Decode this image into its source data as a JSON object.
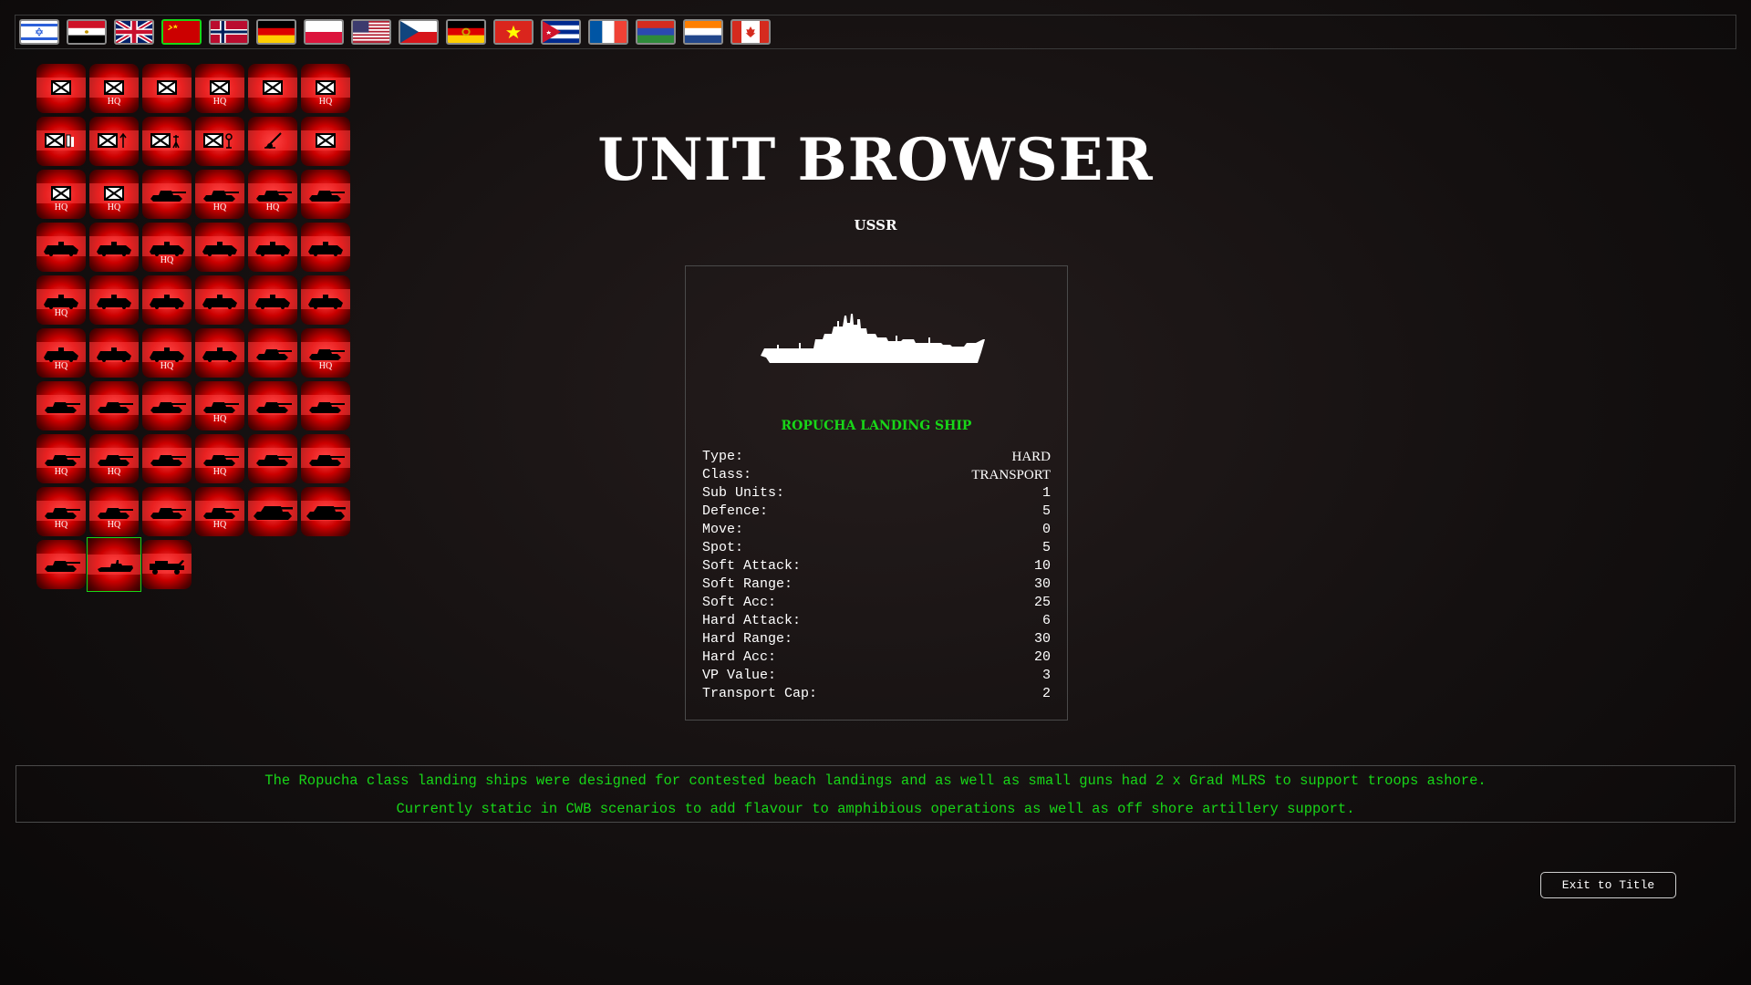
{
  "header": {
    "title": "UNIT BROWSER",
    "nation": "USSR"
  },
  "flags": [
    {
      "name": "israel-flag",
      "selected": false
    },
    {
      "name": "egypt-flag",
      "selected": false
    },
    {
      "name": "uk-flag",
      "selected": false
    },
    {
      "name": "ussr-flag",
      "selected": true
    },
    {
      "name": "norway-flag",
      "selected": false
    },
    {
      "name": "west-germany-flag",
      "selected": false
    },
    {
      "name": "poland-flag",
      "selected": false
    },
    {
      "name": "usa-flag",
      "selected": false
    },
    {
      "name": "czechoslovakia-flag",
      "selected": false
    },
    {
      "name": "east-germany-flag",
      "selected": false
    },
    {
      "name": "vietnam-flag",
      "selected": false
    },
    {
      "name": "cuba-flag",
      "selected": false
    },
    {
      "name": "france-flag",
      "selected": false
    },
    {
      "name": "red-blue-green-flag",
      "selected": false
    },
    {
      "name": "netherlands-flag",
      "selected": false
    },
    {
      "name": "canada-flag",
      "selected": false
    }
  ],
  "units": [
    {
      "icon": "infantry-icon",
      "hq": false
    },
    {
      "icon": "infantry-icon",
      "hq": true
    },
    {
      "icon": "infantry-icon",
      "hq": false
    },
    {
      "icon": "infantry-icon",
      "hq": true
    },
    {
      "icon": "infantry-icon",
      "hq": false
    },
    {
      "icon": "infantry-icon",
      "hq": true
    },
    {
      "icon": "infantry-mortar-icon",
      "hq": false
    },
    {
      "icon": "infantry-atgm-icon",
      "hq": false
    },
    {
      "icon": "infantry-mg-icon",
      "hq": false
    },
    {
      "icon": "infantry-aa-icon",
      "hq": false
    },
    {
      "icon": "artillery-gun-icon",
      "hq": false
    },
    {
      "icon": "infantry-icon",
      "hq": false
    },
    {
      "icon": "infantry-icon",
      "hq": true
    },
    {
      "icon": "infantry-icon",
      "hq": true
    },
    {
      "icon": "tank-icon",
      "hq": false
    },
    {
      "icon": "tank-icon",
      "hq": true
    },
    {
      "icon": "tank-icon",
      "hq": true
    },
    {
      "icon": "tank-icon",
      "hq": false
    },
    {
      "icon": "apc-icon",
      "hq": false
    },
    {
      "icon": "apc-icon",
      "hq": false
    },
    {
      "icon": "apc-icon",
      "hq": true
    },
    {
      "icon": "apc-icon",
      "hq": false
    },
    {
      "icon": "apc-icon",
      "hq": false
    },
    {
      "icon": "apc-icon",
      "hq": false
    },
    {
      "icon": "apc-icon",
      "hq": true
    },
    {
      "icon": "apc-icon",
      "hq": false
    },
    {
      "icon": "apc-icon",
      "hq": false
    },
    {
      "icon": "apc-icon",
      "hq": false
    },
    {
      "icon": "apc-icon",
      "hq": false
    },
    {
      "icon": "apc-icon",
      "hq": false
    },
    {
      "icon": "apc-icon",
      "hq": true
    },
    {
      "icon": "apc-icon",
      "hq": false
    },
    {
      "icon": "apc-icon",
      "hq": true
    },
    {
      "icon": "apc-icon",
      "hq": false
    },
    {
      "icon": "tank-icon",
      "hq": false
    },
    {
      "icon": "tank-icon",
      "hq": true
    },
    {
      "icon": "tank-icon",
      "hq": false
    },
    {
      "icon": "tank-icon",
      "hq": false
    },
    {
      "icon": "tank-icon",
      "hq": false
    },
    {
      "icon": "tank-icon",
      "hq": true
    },
    {
      "icon": "tank-icon",
      "hq": false
    },
    {
      "icon": "tank-icon",
      "hq": false
    },
    {
      "icon": "tank-icon",
      "hq": true
    },
    {
      "icon": "tank-icon",
      "hq": true
    },
    {
      "icon": "tank-icon",
      "hq": false
    },
    {
      "icon": "tank-icon",
      "hq": true
    },
    {
      "icon": "tank-icon",
      "hq": false
    },
    {
      "icon": "tank-icon",
      "hq": false
    },
    {
      "icon": "tank-icon",
      "hq": true
    },
    {
      "icon": "tank-icon",
      "hq": true
    },
    {
      "icon": "tank-icon",
      "hq": false
    },
    {
      "icon": "tank-icon",
      "hq": true
    },
    {
      "icon": "heavy-tank-icon",
      "hq": false
    },
    {
      "icon": "heavy-tank-icon",
      "hq": false
    },
    {
      "icon": "tank-icon",
      "hq": false
    },
    {
      "icon": "landing-ship-icon",
      "hq": false,
      "selected": true
    },
    {
      "icon": "truck-icon",
      "hq": false
    }
  ],
  "selected_unit": {
    "name": "ROPUCHA LANDING SHIP",
    "image_icon": "landing-ship-icon",
    "stats": [
      {
        "label": "Type:",
        "value": "HARD"
      },
      {
        "label": "Class:",
        "value": "TRANSPORT"
      },
      {
        "label": "Sub Units:",
        "value": "1"
      },
      {
        "label": "Defence:",
        "value": "5"
      },
      {
        "label": "Move:",
        "value": "0"
      },
      {
        "label": "Spot:",
        "value": "5"
      },
      {
        "label": "Soft Attack:",
        "value": "10"
      },
      {
        "label": "Soft Range:",
        "value": "30"
      },
      {
        "label": "Soft Acc:",
        "value": "25"
      },
      {
        "label": "Hard Attack:",
        "value": "6"
      },
      {
        "label": "Hard Range:",
        "value": "30"
      },
      {
        "label": "Hard Acc:",
        "value": "20"
      },
      {
        "label": "VP Value:",
        "value": "3"
      },
      {
        "label": "Transport Cap:",
        "value": "2"
      }
    ]
  },
  "description": {
    "line1": "The Ropucha class landing ships were designed for contested beach landings and as well as small guns had 2 x Grad MLRS to support troops ashore.",
    "line2": "Currently static in CWB scenarios to add flavour to amphibious operations as well as off shore artillery support."
  },
  "buttons": {
    "exit_label": "Exit to Title"
  },
  "colors": {
    "accent_green": "#18d618",
    "tile_red": "#cc0000",
    "background": "#141010"
  },
  "hq_label": "HQ"
}
